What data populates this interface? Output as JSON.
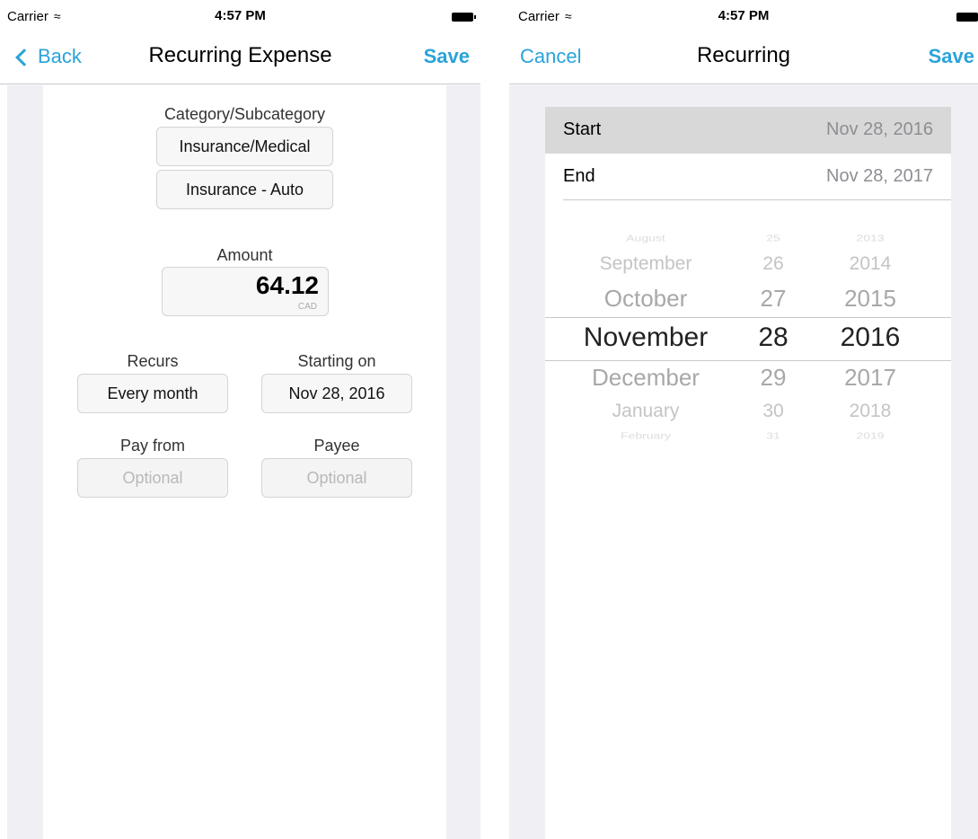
{
  "status": {
    "carrier": "Carrier",
    "time": "4:57 PM"
  },
  "left": {
    "nav": {
      "back": "Back",
      "title": "Recurring Expense",
      "save": "Save"
    },
    "category_label": "Category/Subcategory",
    "category": "Insurance/Medical",
    "subcategory": "Insurance - Auto",
    "amount_label": "Amount",
    "amount": "64.12",
    "currency": "CAD",
    "recurs_label": "Recurs",
    "recurs": "Every month",
    "starting_label": "Starting on",
    "starting": "Nov 28, 2016",
    "payfrom_label": "Pay from",
    "payfrom_placeholder": "Optional",
    "payee_label": "Payee",
    "payee_placeholder": "Optional"
  },
  "right": {
    "nav": {
      "cancel": "Cancel",
      "title": "Recurring",
      "save": "Save"
    },
    "start_label": "Start",
    "start_value": "Nov 28, 2016",
    "end_label": "End",
    "end_value": "Nov 28, 2017",
    "picker": {
      "months": [
        "August",
        "September",
        "October",
        "November",
        "December",
        "January",
        "February"
      ],
      "days": [
        "25",
        "26",
        "27",
        "28",
        "29",
        "30",
        "31"
      ],
      "years": [
        "2013",
        "2014",
        "2015",
        "2016",
        "2017",
        "2018",
        "2019"
      ],
      "selected_index": 3
    }
  },
  "colors": {
    "accent": "#2aa3da",
    "side": "#efeff4",
    "selected_row": "#d8d8d8"
  }
}
